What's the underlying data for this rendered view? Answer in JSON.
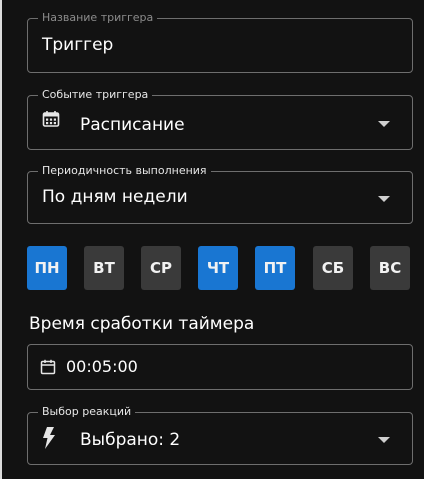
{
  "trigger_name": {
    "label": "Название триггера",
    "value": "Триггер"
  },
  "trigger_event": {
    "label": "Событие триггера",
    "value": "Расписание",
    "icon": "calendar-icon"
  },
  "periodicity": {
    "label": "Периодичность выполнения",
    "value": "По дням недели"
  },
  "days": [
    {
      "label": "ПН",
      "selected": true
    },
    {
      "label": "ВТ",
      "selected": false
    },
    {
      "label": "СР",
      "selected": false
    },
    {
      "label": "ЧТ",
      "selected": true
    },
    {
      "label": "ПТ",
      "selected": true
    },
    {
      "label": "СБ",
      "selected": false
    },
    {
      "label": "ВС",
      "selected": false
    }
  ],
  "timer": {
    "title": "Время сработки таймера",
    "value": "00:05:00",
    "icon": "calendar-icon"
  },
  "reactions": {
    "label": "Выбор реакций",
    "value": "Выбрано: 2",
    "icon": "lightning-icon"
  },
  "colors": {
    "panel_bg": "#121212",
    "accent": "#1976d2",
    "day_off_bg": "#3a3a3a",
    "border": "#6e6e6e"
  }
}
